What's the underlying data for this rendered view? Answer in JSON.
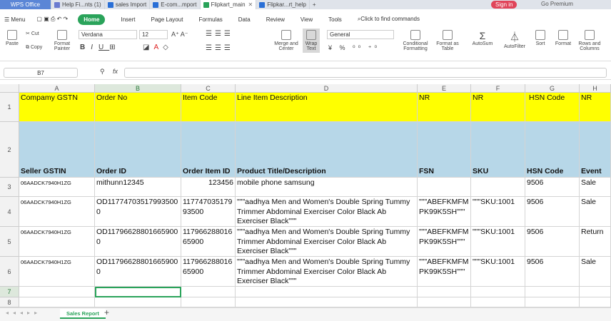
{
  "tabs": [
    {
      "label": "WPS Office",
      "color": "#5b86d6"
    },
    {
      "label": "Help Fi...nts (1)",
      "color": "#6a7bd0"
    },
    {
      "label": "sales Import",
      "color": "#2a6fd6"
    },
    {
      "label": "E-com...mport",
      "color": "#2a6fd6"
    },
    {
      "label": "Flipkart_main",
      "color": "#2aa35a"
    },
    {
      "label": "Flipkar...rt_help",
      "color": "#2a6fd6"
    }
  ],
  "signin_label": "Sign in",
  "premium_label": "Go Premium",
  "menu": {
    "menu_label": "Menu",
    "items": [
      "Home",
      "Insert",
      "Page Layout",
      "Formulas",
      "Data",
      "Review",
      "View",
      "Tools"
    ],
    "search": "Click to find commands"
  },
  "toolbar": {
    "paste": "Paste",
    "cut": "Cut",
    "copy": "Copy",
    "format_painter": "Format Painter",
    "font": "Verdana",
    "size": "12",
    "merge": "Merge and Center",
    "wrap": "Wrap Text",
    "number_format": "General",
    "conditional": "Conditional Formatting",
    "format_table": "Format as Table",
    "autosum": "AutoSum",
    "autofilter": "AutoFilter",
    "sort": "Sort",
    "format": "Format",
    "rows_cols": "Rows and Columns"
  },
  "formula": {
    "cell_ref": "B7",
    "fx": "fx",
    "value": ""
  },
  "columns": [
    "A",
    "B",
    "C",
    "D",
    "E",
    "F",
    "G",
    "H"
  ],
  "rows": [
    "1",
    "2",
    "3",
    "4",
    "5",
    "6",
    "7",
    "8"
  ],
  "row1": [
    "Compamy GSTN",
    "Order No",
    "Item Code",
    "Line Item Description",
    "NR",
    "NR",
    "HSN Code",
    "NR"
  ],
  "row2": [
    "Seller GSTIN",
    "Order ID",
    "Order Item ID",
    "Product Title/Description",
    "FSN",
    "SKU",
    "HSN Code",
    "Event"
  ],
  "row3": [
    "06AADCK7940H1ZG",
    "mithunn12345",
    "123456",
    "mobile phone samsung",
    "",
    "",
    "9506",
    "Sale"
  ],
  "row4": [
    "06AADCK7940H1ZG",
    "OD117747035179935000",
    "11774703517993500",
    "\"\"\"aadhya Men and Women's Double Spring Tummy Trimmer Abdominal Exerciser Color Black Ab Exerciser Black\"\"\"",
    "\"\"\"ABEFKMFMPK99K5SH\"\"\"",
    "\"\"\"SKU:1001",
    "9506",
    "Sale"
  ],
  "row5": [
    "06AADCK7940H1ZG",
    "OD117966288016659000",
    "11796628801665900",
    "\"\"\"aadhya Men and Women's Double Spring Tummy Trimmer Abdominal Exerciser Color Black Ab Exerciser Black\"\"\"",
    "\"\"\"ABEFKMFMPK99K5SH\"\"\"",
    "\"\"\"SKU:1001",
    "9506",
    "Return"
  ],
  "row6": [
    "06AADCK7940H1ZG",
    "OD117966288016659000",
    "11796628801665900",
    "\"\"\"aadhya Men and Women's Double Spring Tummy Trimmer Abdominal Exerciser Color Black Ab Exerciser Black\"\"\"",
    "\"\"\"ABEFKMFMPK99K5SH\"\"\"",
    "\"\"\"SKU:1001",
    "9506",
    "Sale"
  ],
  "sheet_tab": "Sales Report"
}
